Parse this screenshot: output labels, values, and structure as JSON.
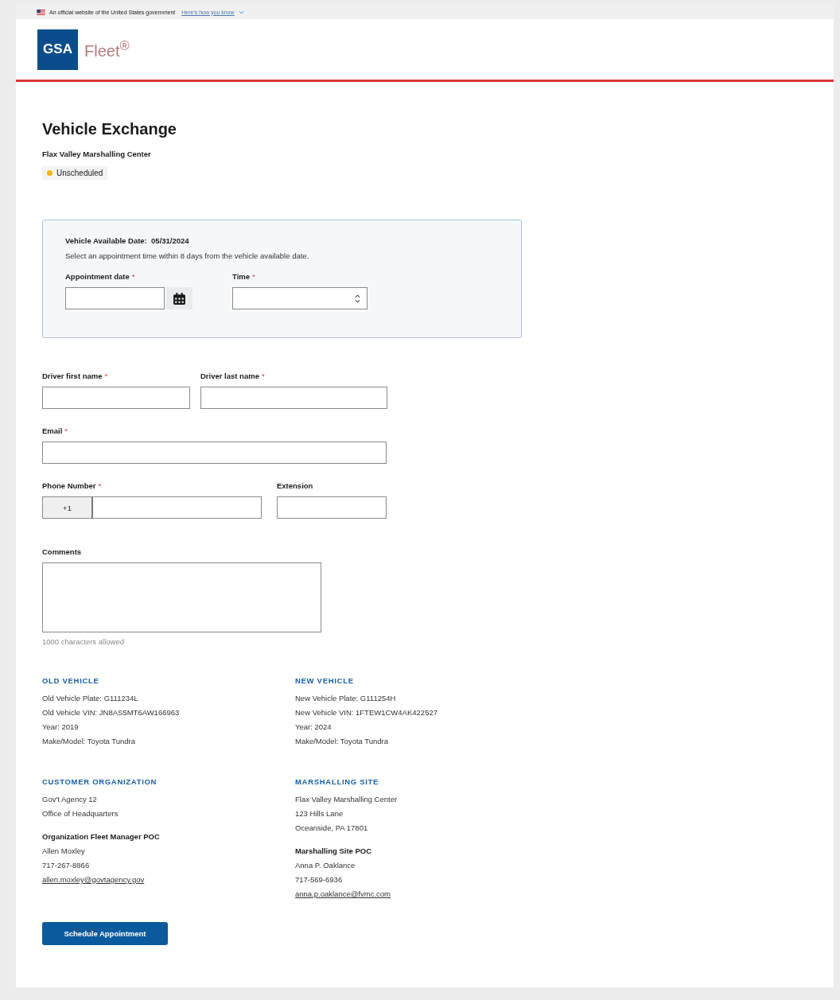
{
  "banner": {
    "text": "An official website of the United States government",
    "link": "Here's how you know"
  },
  "logo": {
    "mark": "GSA",
    "product": "Fleet$^{®}$"
  },
  "title": "Vehicle Exchange",
  "subtitle": "Flax Valley Marshalling Center",
  "status": {
    "label": "Unscheduled",
    "color": "#f2b600"
  },
  "required_mark": "*",
  "availability": {
    "label": "Vehicle Available Date:",
    "date": "05/31/2024",
    "note": "Select an appointment time within 8 days from the vehicle available date.",
    "fields": [
      {
        "label": "Appointment date",
        "required": true,
        "kind": "date"
      },
      {
        "label": "Time",
        "required": true,
        "kind": "select"
      }
    ]
  },
  "fields": [
    {
      "label": "Driver first name",
      "required": true,
      "kind": "half"
    },
    {
      "label": "Driver last name",
      "required": true,
      "kind": "half"
    },
    {
      "label": "Email",
      "required": true,
      "kind": "full"
    },
    {
      "label": "Phone Number",
      "required": true,
      "kind": "phone",
      "prefix": "+1"
    },
    {
      "label": "Extension",
      "required": false,
      "kind": "ext"
    },
    {
      "label": "Comments",
      "required": false,
      "kind": "textarea",
      "hint": "1000 characters allowed"
    }
  ],
  "sections": [
    {
      "heading": "OLD VEHICLE",
      "lines": [
        "Old Vehicle Plate:  G111234L",
        "Old Vehicle VIN: JN8AS5MT6AW166963",
        "Year: 2019",
        "Make/Model: Toyota Tundra"
      ]
    },
    {
      "heading": "NEW VEHICLE",
      "lines": [
        "New Vehicle Plate:  G111254H",
        "New Vehicle VIN: 1FTEW1CW4AK422527",
        "Year: 2024",
        "Make/Model: Toyota Tundra"
      ]
    },
    {
      "heading": "CUSTOMER ORGANIZATION",
      "lines": [
        "Gov't Agency 12",
        "Office of Headquarters"
      ],
      "contact": {
        "heading": "Organization Fleet Manager POC",
        "lines": [
          "Allen Moxley",
          "717-267-8866"
        ],
        "email": "allen.moxley@govtagency.gov"
      }
    },
    {
      "heading": "MARSHALLING SITE",
      "lines": [
        "Flax Valley Marshalling Center",
        "123 Hills Lane",
        "Oceanside, PA 17801"
      ],
      "contact": {
        "heading": "Marshalling Site POC",
        "lines": [
          "Anna P. Oaklance",
          "717-569-6936"
        ],
        "email": "anna.p.oaklance@fvmc.com"
      }
    }
  ],
  "submit": "Schedule Appointment"
}
